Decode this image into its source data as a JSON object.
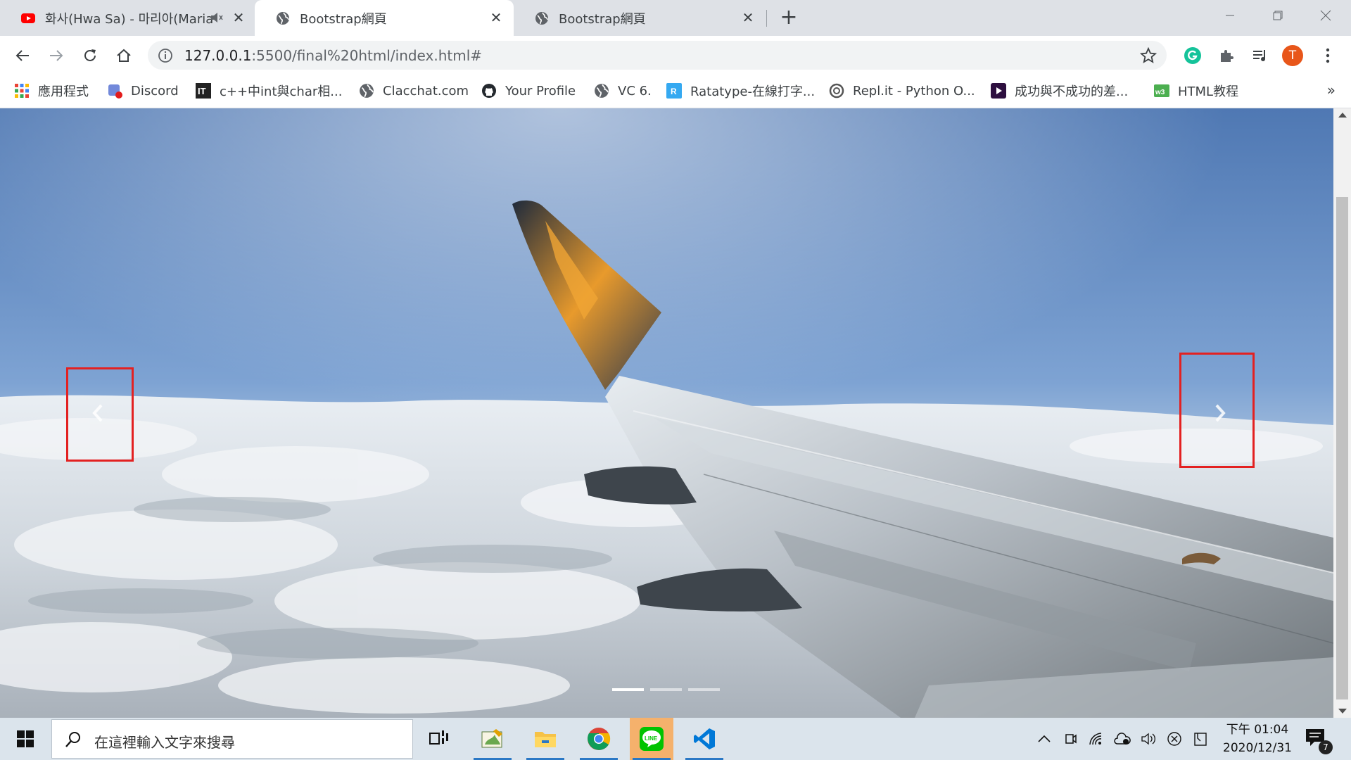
{
  "browser": {
    "tabs": [
      {
        "title": "화사(Hwa Sa) - 마리아(Maria",
        "icon": "youtube-icon",
        "muted_indicator": true
      },
      {
        "title": "Bootstrap網頁",
        "icon": "globe-icon",
        "active": true
      },
      {
        "title": "Bootstrap網頁",
        "icon": "globe-icon"
      }
    ],
    "close_glyph": "✕",
    "new_tab_glyph": "+",
    "address": {
      "host": "127.0.0.1",
      "path": ":5500/final%20html/index.html#"
    },
    "profile_initial": "T",
    "bookmarks": [
      {
        "label": "應用程式",
        "icon": "apps-grid-icon"
      },
      {
        "label": "Discord",
        "icon": "discord-icon"
      },
      {
        "label": "c++中int與char相...",
        "icon": "ithome-icon"
      },
      {
        "label": "Clacchat.com",
        "icon": "globe-icon"
      },
      {
        "label": "Your Profile",
        "icon": "github-icon"
      },
      {
        "label": "VC 6.",
        "icon": "globe-icon"
      },
      {
        "label": "Ratatype-在線打字...",
        "icon": "ratatype-icon"
      },
      {
        "label": "Repl.it - Python O...",
        "icon": "replit-icon"
      },
      {
        "label": "成功與不成功的差...",
        "icon": "video-play-icon"
      },
      {
        "label": "HTML教程",
        "icon": "w3-icon"
      }
    ],
    "bookmarks_overflow": "»"
  },
  "page": {
    "carousel": {
      "image": "airplane-wing-above-clouds",
      "slides": 3,
      "active_slide": 1,
      "highlight_color": "#e32121"
    }
  },
  "taskbar": {
    "search_placeholder": "在這裡輸入文字來搜尋",
    "apps": [
      "task-view-icon",
      "paint-app-icon",
      "file-explorer-icon",
      "chrome-icon",
      "line-app-icon",
      "vscode-icon"
    ],
    "clock_time": "下午 01:04",
    "clock_date": "2020/12/31",
    "notification_count": "7"
  }
}
